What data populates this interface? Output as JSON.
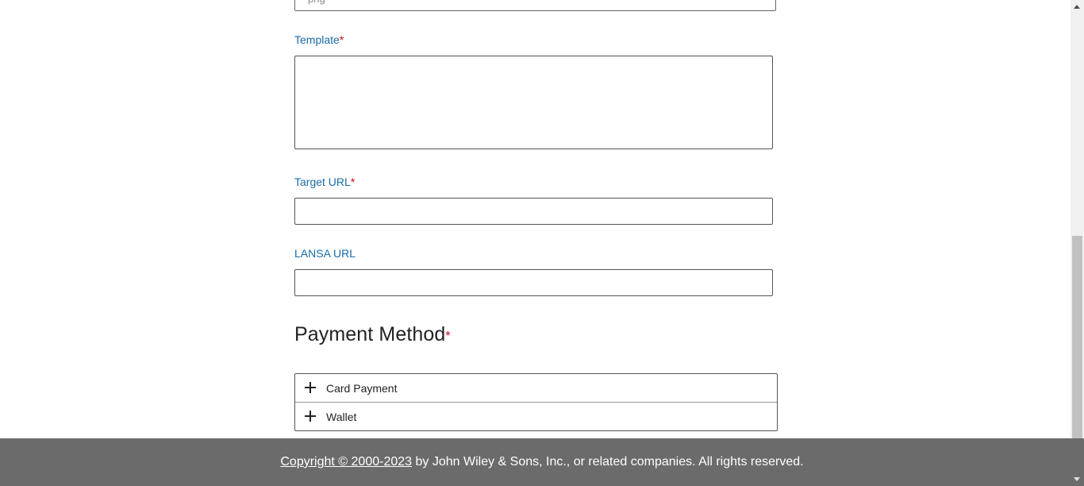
{
  "form": {
    "prev_field_value": "png",
    "template": {
      "label": "Template",
      "required_mark": "*",
      "value": ""
    },
    "target_url": {
      "label": "Target URL",
      "required_mark": "*",
      "value": ""
    },
    "lansa_url": {
      "label": "LANSA URL",
      "value": ""
    }
  },
  "payment": {
    "title": "Payment Method",
    "required_mark": "*",
    "options": [
      {
        "label": "Card Payment",
        "icon": "plus-icon"
      },
      {
        "label": "Wallet",
        "icon": "plus-icon"
      }
    ]
  },
  "footer": {
    "copyright_link": "Copyright © 2000-2023",
    "copyright_rest": " by John Wiley & Sons, Inc., or related companies. All rights reserved."
  },
  "colors": {
    "label_blue": "#1a6aa8",
    "required_red": "#d0021b",
    "footer_bg": "#6b6b6b"
  }
}
